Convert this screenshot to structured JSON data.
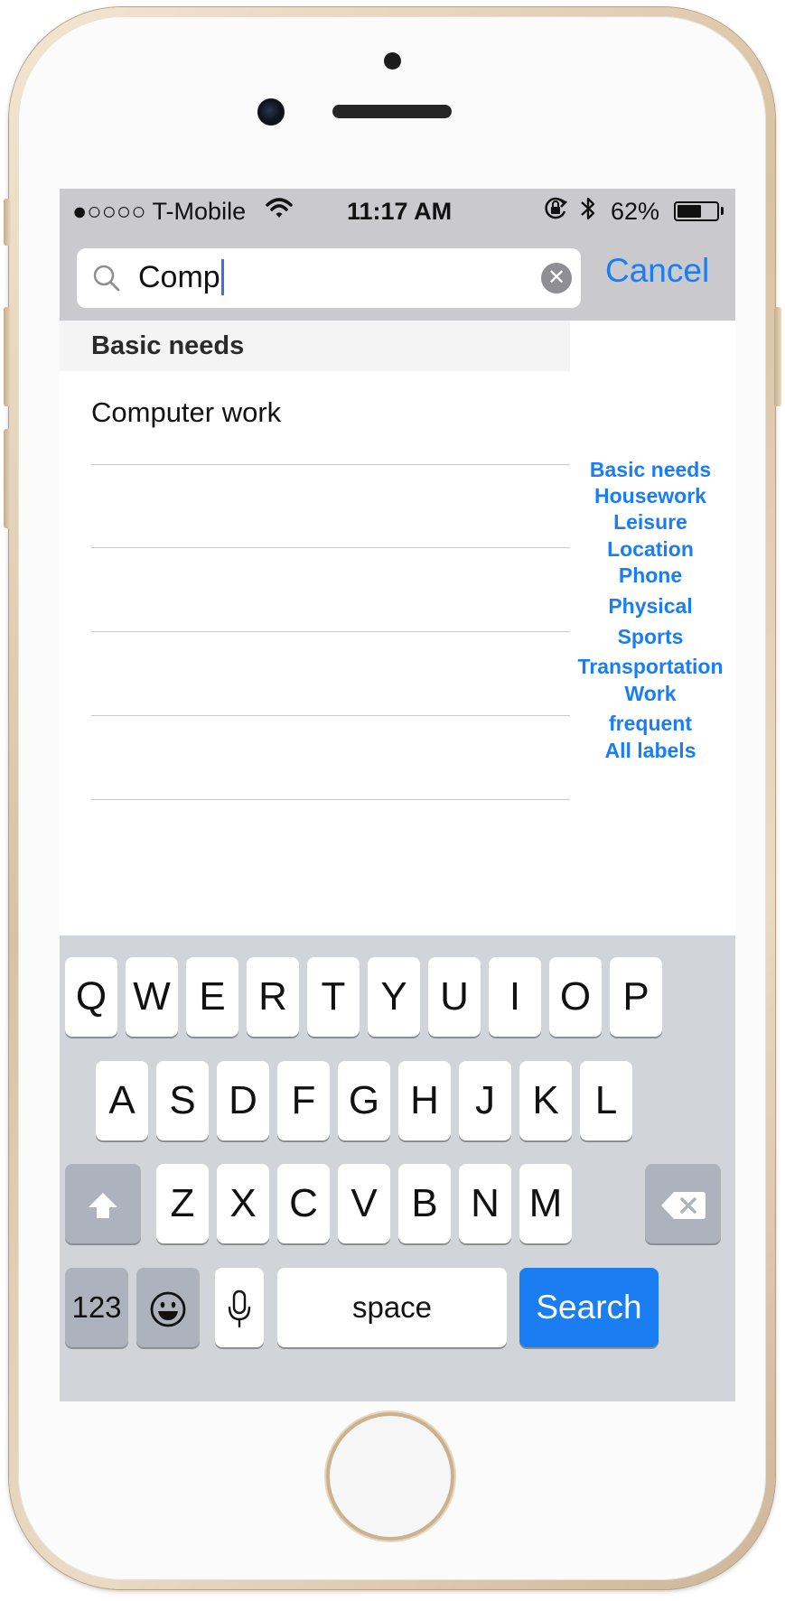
{
  "status_bar": {
    "carrier": "●○○○○ T-Mobile",
    "time": "11:17 AM",
    "battery_percent": "62%",
    "battery_level": 0.62
  },
  "search": {
    "query": "Comp",
    "cancel_label": "Cancel"
  },
  "results": {
    "section_header": "Basic needs",
    "items": [
      "Computer work",
      "",
      "",
      "",
      ""
    ]
  },
  "index": {
    "items": [
      "Basic needs",
      "Housework",
      "Leisure",
      "Location",
      "Phone",
      "Physical",
      "Sports",
      "Transportation",
      "Work",
      "frequent",
      "All labels"
    ]
  },
  "keyboard": {
    "row1": [
      "Q",
      "W",
      "E",
      "R",
      "T",
      "Y",
      "U",
      "I",
      "O",
      "P"
    ],
    "row2": [
      "A",
      "S",
      "D",
      "F",
      "G",
      "H",
      "J",
      "K",
      "L"
    ],
    "row3": [
      "Z",
      "X",
      "C",
      "V",
      "B",
      "N",
      "M"
    ],
    "numbers_label": "123",
    "space_label": "space",
    "search_label": "Search",
    "icons": {
      "shift": "shift-icon",
      "delete": "delete-icon",
      "emoji": "emoji-icon",
      "mic": "microphone-icon"
    }
  },
  "colors": {
    "accent": "#1a7ef2",
    "bar_gray": "#c9c9ce",
    "keyboard_bg": "#d1d4d9"
  }
}
